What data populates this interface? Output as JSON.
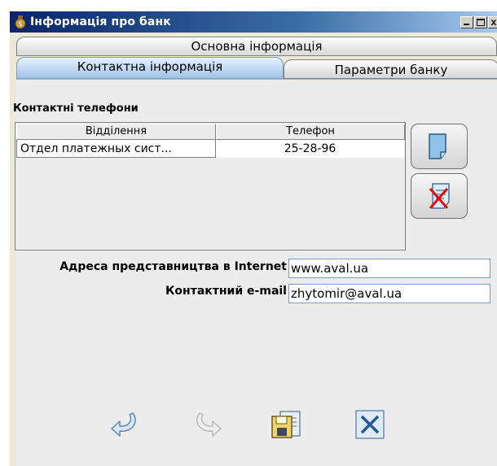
{
  "window": {
    "title": "Інформація про банк",
    "icons": {
      "app": "bank-app-icon",
      "minimize": "minimize-icon",
      "maximize": "maximize-icon",
      "close": "close-icon"
    },
    "close_glyph": "x"
  },
  "tabs": [
    {
      "label": "Основна інформація",
      "active": false
    },
    {
      "label": "Контактна інформація",
      "active": true
    },
    {
      "label": "Параметри банку",
      "active": false
    }
  ],
  "contacts": {
    "section_title": "Контактні телефони",
    "columns": [
      "Відділення",
      "Телефон"
    ],
    "rows": [
      {
        "department": "Отдел платежных сист...",
        "phone": "25-28-96"
      }
    ],
    "buttons": {
      "add": "new-document-icon",
      "delete": "delete-document-icon"
    }
  },
  "internet": {
    "url_label": "Адреса представництва в Internet",
    "url_value": "www.aval.ua",
    "email_label": "Контактний e-mail",
    "email_value": "zhytomir@aval.ua"
  },
  "toolbar": {
    "icons": [
      "undo-icon",
      "redo-icon",
      "save-icon",
      "cancel-icon"
    ]
  },
  "colors": {
    "titlebar_start": "#0a246a",
    "titlebar_end": "#a6caf0",
    "active_tab": "#bcd6f0",
    "panel_bg": "#ececec"
  }
}
